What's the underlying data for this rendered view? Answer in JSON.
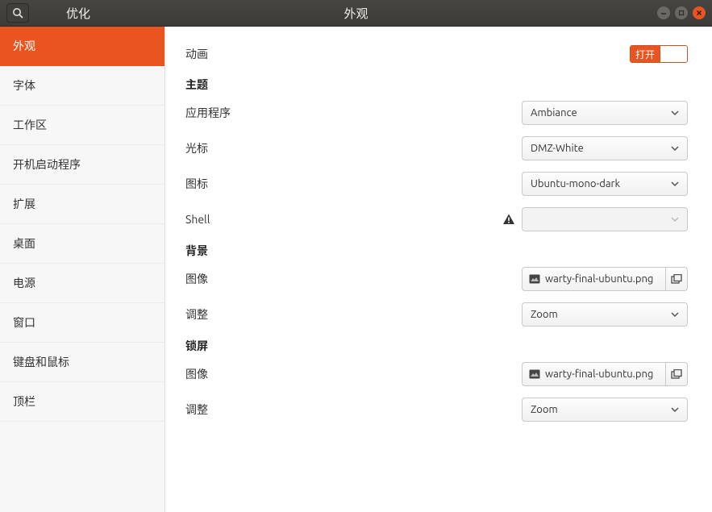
{
  "titlebar": {
    "left_title": "优化",
    "center_title": "外观"
  },
  "sidebar": {
    "items": [
      {
        "label": "外观",
        "active": true
      },
      {
        "label": "字体",
        "active": false
      },
      {
        "label": "工作区",
        "active": false
      },
      {
        "label": "开机启动程序",
        "active": false
      },
      {
        "label": "扩展",
        "active": false
      },
      {
        "label": "桌面",
        "active": false
      },
      {
        "label": "电源",
        "active": false
      },
      {
        "label": "窗口",
        "active": false
      },
      {
        "label": "键盘和鼠标",
        "active": false
      },
      {
        "label": "顶栏",
        "active": false
      }
    ]
  },
  "main": {
    "animations": {
      "label": "动画",
      "toggle_label": "打开"
    },
    "theme": {
      "heading": "主题",
      "app_label": "应用程序",
      "app_value": "Ambiance",
      "cursor_label": "光标",
      "cursor_value": "DMZ-White",
      "icons_label": "图标",
      "icons_value": "Ubuntu-mono-dark",
      "shell_label": "Shell",
      "shell_value": ""
    },
    "background": {
      "heading": "背景",
      "image_label": "图像",
      "image_value": "warty-final-ubuntu.png",
      "adjust_label": "调整",
      "adjust_value": "Zoom"
    },
    "lock": {
      "heading": "锁屏",
      "image_label": "图像",
      "image_value": "warty-final-ubuntu.png",
      "adjust_label": "调整",
      "adjust_value": "Zoom"
    }
  }
}
